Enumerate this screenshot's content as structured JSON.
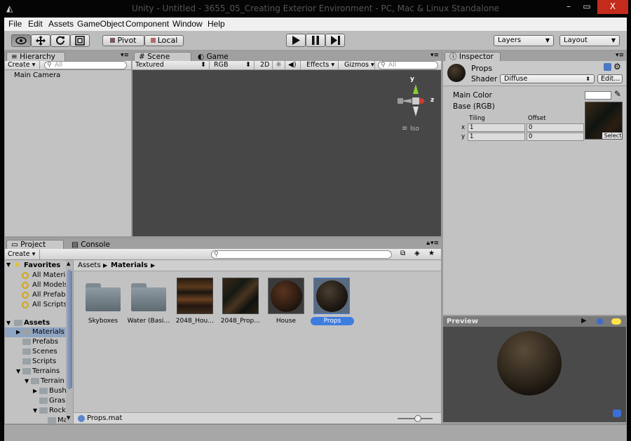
{
  "titlebar": {
    "logo": "◭",
    "title": "Unity - Untitled - 3655_05_Creating Exterior Environment - PC, Mac & Linux Standalone",
    "min": "–",
    "max": "▭",
    "close": "X"
  },
  "menubar": {
    "items": [
      "File",
      "Edit",
      "Assets",
      "GameObject",
      "Component",
      "Window",
      "Help"
    ]
  },
  "toolbar": {
    "pivot": "Pivot",
    "local": "Local",
    "layers": "Layers",
    "layout": "Layout"
  },
  "hierarchy": {
    "tab": "Hierarchy",
    "create": "Create",
    "search_placeholder": "All",
    "items": [
      "Main Camera"
    ]
  },
  "scene": {
    "tab_scene": "Scene",
    "tab_game": "Game",
    "shading": "Textured",
    "render": "RGB",
    "mode2d": "2D",
    "effects": "Effects",
    "gizmos": "Gizmos",
    "search_placeholder": "All",
    "gizmo_y": "y",
    "gizmo_z": "z",
    "projection": "Iso",
    "bg": "#474747"
  },
  "inspector": {
    "tab": "Inspector",
    "material_name": "Props",
    "shader_label": "Shader",
    "shader_value": "Diffuse",
    "edit_button": "Edit...",
    "main_color_label": "Main Color",
    "base_label": "Base (RGB)",
    "tiling_label": "Tiling",
    "offset_label": "Offset",
    "x_label": "x",
    "y_label": "y",
    "tiling_x": "1",
    "tiling_y": "1",
    "offset_x": "0",
    "offset_y": "0",
    "select_button": "Select"
  },
  "preview": {
    "label": "Preview"
  },
  "project": {
    "tab_project": "Project",
    "tab_console": "Console",
    "create": "Create",
    "favorites_label": "Favorites",
    "favorites": [
      "All Materi",
      "All Models",
      "All Prefab",
      "All Scripts"
    ],
    "assets_label": "Assets",
    "tree": [
      "Materials",
      "Prefabs",
      "Scenes",
      "Scripts",
      "Terrains",
      "Terrain",
      "Bush",
      "Gras",
      "Rock",
      "Ma"
    ],
    "breadcrumb_root": "Assets",
    "breadcrumb_current": "Materials",
    "assets": [
      "Skyboxes",
      "Water (Basi…",
      "2048_Hou…",
      "2048_Prop…",
      "House",
      "Props"
    ],
    "footer_file": "Props.mat"
  },
  "colors": {
    "accent": "#3b6fd8",
    "selected_label_bg": "#3e7de0",
    "selection": "#8fa5c4"
  }
}
